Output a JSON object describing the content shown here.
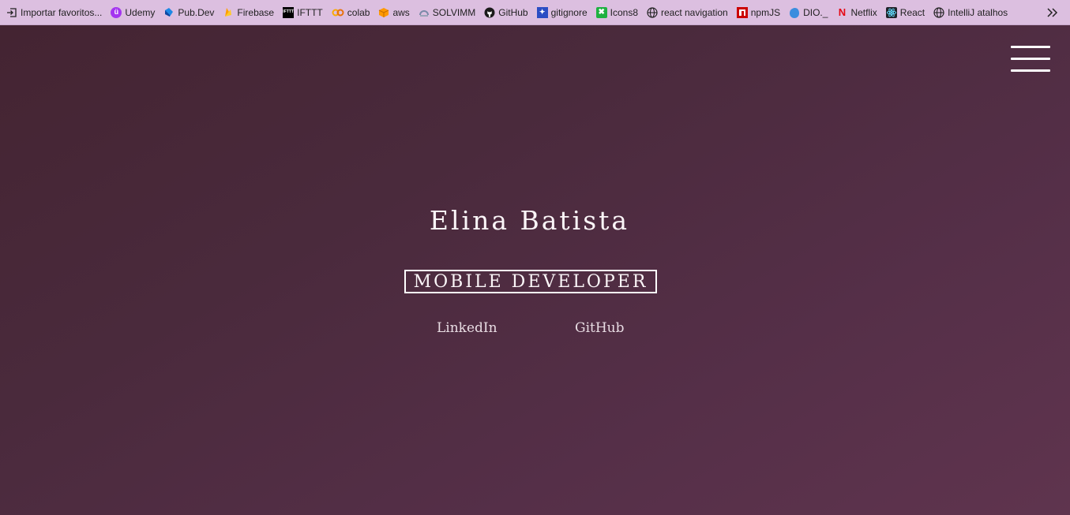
{
  "bookmarks": [
    {
      "label": "Importar favoritos...",
      "icon": "import-icon"
    },
    {
      "label": "Udemy",
      "icon": "udemy-icon"
    },
    {
      "label": "Pub.Dev",
      "icon": "dart-icon"
    },
    {
      "label": "Firebase",
      "icon": "firebase-icon"
    },
    {
      "label": "IFTTT",
      "icon": "ifttt-icon"
    },
    {
      "label": "colab",
      "icon": "colab-icon"
    },
    {
      "label": "aws",
      "icon": "aws-icon"
    },
    {
      "label": "SOLVIMM",
      "icon": "solvimm-icon"
    },
    {
      "label": "GitHub",
      "icon": "github-icon"
    },
    {
      "label": "gitignore",
      "icon": "gitignore-icon"
    },
    {
      "label": "Icons8",
      "icon": "icons8-icon"
    },
    {
      "label": "react navigation",
      "icon": "globe-icon"
    },
    {
      "label": "npmJS",
      "icon": "npm-icon"
    },
    {
      "label": "DIO._",
      "icon": "dio-icon"
    },
    {
      "label": "Netflix",
      "icon": "netflix-icon"
    },
    {
      "label": "React",
      "icon": "react-icon"
    },
    {
      "label": "IntelliJ atalhos",
      "icon": "globe-icon"
    }
  ],
  "hero": {
    "name": "Elina Batista",
    "role": "MOBILE DEVELOPER",
    "links": {
      "linkedin": "LinkedIn",
      "github": "GitHub"
    }
  },
  "colors": {
    "bookmarks_bar": "#dcbfe0",
    "background_start": "#442432",
    "background_end": "#5f344e",
    "text": "#fbf6f8"
  }
}
